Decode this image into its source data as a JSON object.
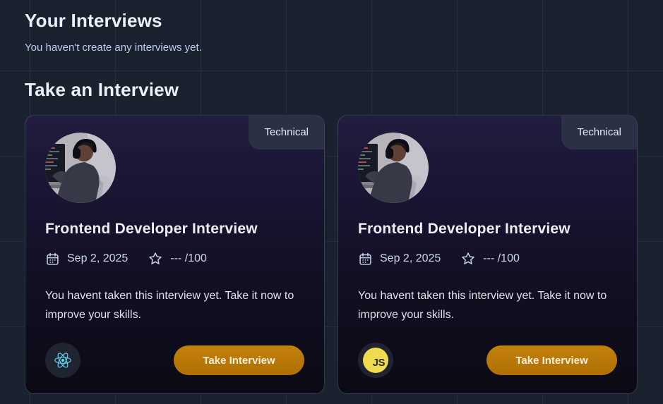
{
  "colors": {
    "page_bg": "#1A2230",
    "card_gradient_top": "#221C3E",
    "card_gradient_bottom": "#0B0A14",
    "badge_bg": "#2A3145",
    "button_amber": "#B87408",
    "react_cyan": "#5ED3F3",
    "js_yellow": "#F0DB4F"
  },
  "your_interviews": {
    "title": "Your Interviews",
    "empty_message": "You haven't create any interviews yet."
  },
  "take_interview_section": {
    "title": "Take an Interview"
  },
  "cards": [
    {
      "badge": "Technical",
      "title": "Frontend Developer Interview",
      "date": "Sep 2, 2025",
      "score": "--- /100",
      "description": "You havent taken this interview yet. Take it now to improve your skills.",
      "tech": "React",
      "button_label": "Take Interview"
    },
    {
      "badge": "Technical",
      "title": "Frontend Developer Interview",
      "date": "Sep 2, 2025",
      "score": "--- /100",
      "description": "You havent taken this interview yet. Take it now to improve your skills.",
      "tech": "JavaScript",
      "tech_label": "JS",
      "button_label": "Take Interview"
    }
  ]
}
